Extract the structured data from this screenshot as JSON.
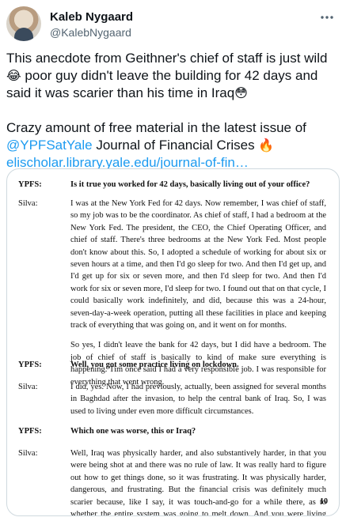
{
  "author": {
    "name": "Kaleb Nygaard",
    "handle": "@KalebNygaard"
  },
  "icons": {
    "more": "more-horizontal-icon",
    "avatar": "profile-photo"
  },
  "tweet": {
    "line1": "This anecdote from Geithner's chief of staff is just wild ",
    "emoji1": "😂",
    "line1b": " poor guy didn't leave the building for 42 days and said it was scarier than his time in Iraq",
    "emoji2": "😳",
    "line2a": "Crazy amount of free material in the latest issue of ",
    "mention": "@YPFSatYale",
    "line2b": " Journal of Financial Crises ",
    "emoji3": "🔥",
    "link": "elischolar.library.yale.edu/journal-of-fin…"
  },
  "document": {
    "entries": [
      {
        "speaker": "YPFS:",
        "type": "q",
        "paras": [
          "Is it true you worked for 42 days, basically living out of your office?"
        ]
      },
      {
        "speaker": "Silva:",
        "type": "a",
        "paras": [
          "I was at the New York Fed for 42 days. Now remember, I was chief of staff, so my job was to be the coordinator. As chief of staff, I had a bedroom at the New York Fed. The president, the CEO, the Chief Operating Officer, and chief of staff. There's three bedrooms at the New York Fed. Most people don't know about this. So, I adopted a schedule of working for about six or seven hours at a time, and then I'd go sleep for two. And then I'd get up, and I'd get up for six or seven more, and then I'd sleep for two. And then I'd work for six or seven more, I'd sleep for two. I found out that on that cycle, I could basically work indefinitely, and did, because this was a 24-hour, seven-day-a-week operation, putting all these facilities in place and keeping track of everything that was going on, and it went on for months.",
          "So yes, I didn't leave the bank for 42 days, but I did have a bedroom. The job of chief of staff is basically to kind of make sure everything is happening. Tim once said I had a very responsible job. I was responsible for everything that went wrong."
        ]
      },
      {
        "speaker": "YPFS:",
        "type": "q",
        "paras": [
          "Well, you got some practice living on lockdown."
        ]
      },
      {
        "speaker": "Silva:",
        "type": "a",
        "paras": [
          "I did, yes. Now, I had previously, actually, been assigned for several months in Baghdad after the invasion, to help the central bank of Iraq. So, I was used to living under even more difficult circumstances."
        ]
      },
      {
        "speaker": "YPFS:",
        "type": "q",
        "paras": [
          "Which one was worse, this or Iraq?"
        ]
      },
      {
        "speaker": "Silva:",
        "type": "a",
        "paras": [
          "Well, Iraq was physically harder, and also substantively harder, in that you were being shot at and there was no rule of law. It was really hard to figure out how to get things done, so it was frustrating. It was physically harder, dangerous, and frustrating. But the financial crisis was definitely much scarier because, like I say, it was touch-and-go for a while there, as to whether the entire system was going to melt down. And you were living right at the center"
        ]
      }
    ],
    "page_number": "10"
  }
}
